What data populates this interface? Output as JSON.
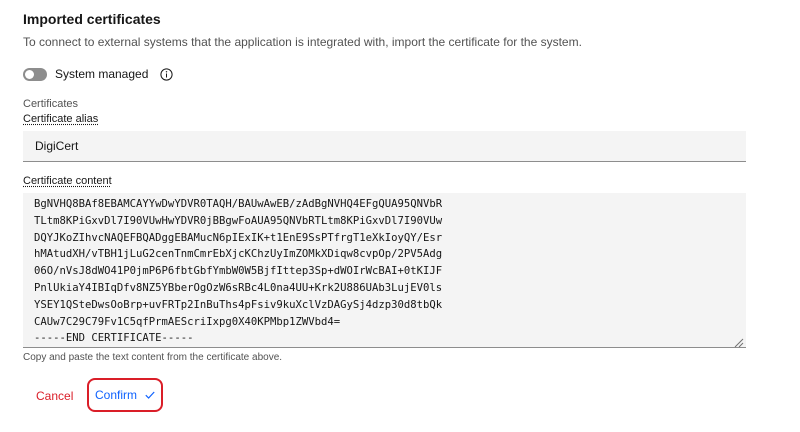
{
  "section": {
    "title": "Imported certificates",
    "description": "To connect to external systems that the application is integrated with, import the certificate for the system."
  },
  "toggle": {
    "label": "System managed",
    "state": "off",
    "info_icon": "info-icon"
  },
  "certificates": {
    "heading": "Certificates",
    "alias_label": "Certificate alias",
    "alias_value": "DigiCert",
    "content_label": "Certificate content",
    "content_lines": [
      "BgNVHQ8BAf8EBAMCAYYwDwYDVR0TAQH/BAUwAwEB/zAdBgNVHQ4EFgQUA95QNVbR",
      "TLtm8KPiGxvDl7I90VUwHwYDVR0jBBgwFoAUA95QNVbRTLtm8KPiGxvDl7I90VUw",
      "DQYJKoZIhvcNAQEFBQADggEBAMucN6pIExIK+t1EnE9SsPTfrgT1eXkIoyQY/Esr",
      "hMAtudXH/vTBH1jLuG2cenTnmCmrEbXjcKChzUyImZOMkXDiqw8cvpOp/2PV5Adg",
      "06O/nVsJ8dWO41P0jmP6P6fbtGbfYmbW0W5BjfIttep3Sp+dWOIrWcBAI+0tKIJF",
      "PnlUkiaY4IBIqDfv8NZ5YBberOgOzW6sRBc4L0na4UU+Krk2U886UAb3LujEV0ls",
      "YSEY1QSteDwsOoBrp+uvFRTp2InBuThs4pFsiv9kuXclVzDAGySj4dzp30d8tbQk",
      "CAUw7C29C79Fv1C5qfPrmAEScriIxpg0X40KPMbp1ZWVbd4=",
      "-----END CERTIFICATE-----"
    ],
    "helper_text": "Copy and paste the text content from the certificate above."
  },
  "actions": {
    "cancel_label": "Cancel",
    "confirm_label": "Confirm",
    "confirm_icon": "checkmark-icon"
  },
  "colors": {
    "danger": "#da1e28",
    "primary": "#0f62fe",
    "field_bg": "#f4f4f4",
    "text_secondary": "#525252"
  }
}
